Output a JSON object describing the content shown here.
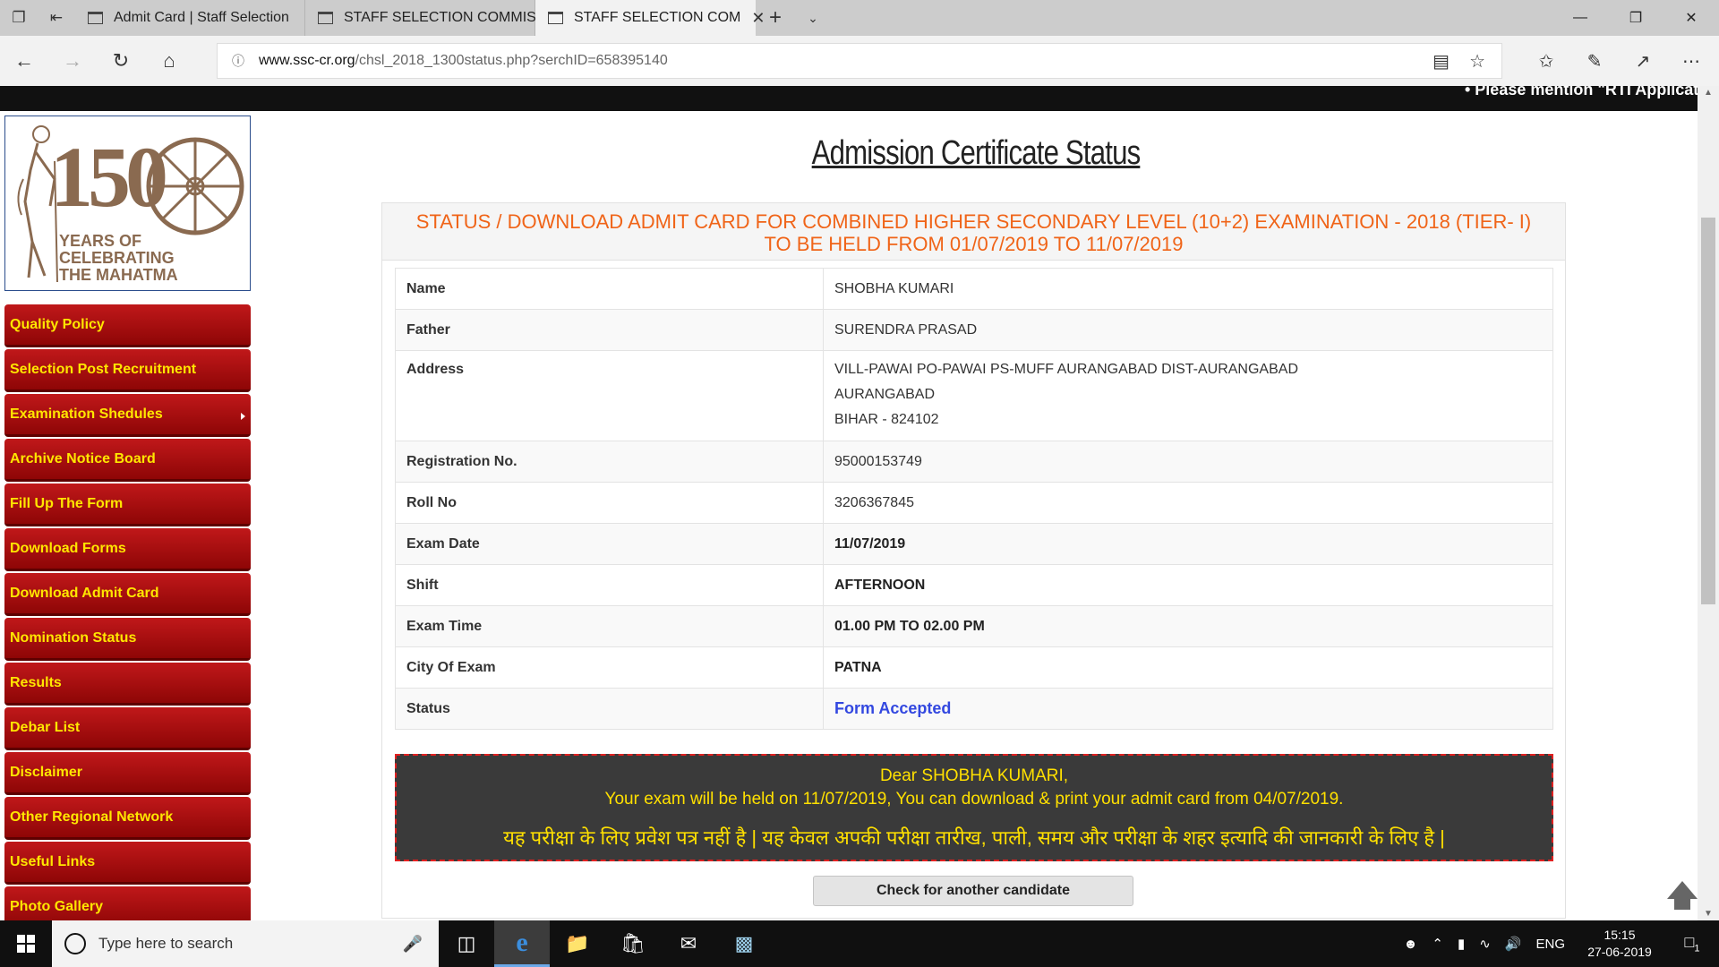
{
  "browser": {
    "tabs": [
      {
        "label": "Admit Card | Staff Selection",
        "active": false
      },
      {
        "label": "STAFF SELECTION COMMIS",
        "active": false
      },
      {
        "label": "STAFF SELECTION COM",
        "active": true
      }
    ],
    "url_host": "www.ssc-cr.org",
    "url_path": "/chsl_2018_1300status.php?serchID=658395140"
  },
  "marquee_text": "• Please mention \"RTI Applicati",
  "logo": {
    "number": "150",
    "line1": "YEARS OF",
    "line2": "CELEBRATING",
    "line3": "THE MAHATMA"
  },
  "sidebar": {
    "items": [
      {
        "label": "Quality Policy"
      },
      {
        "label": "Selection Post Recruitment"
      },
      {
        "label": "Examination Shedules"
      },
      {
        "label": "Archive Notice Board"
      },
      {
        "label": "Fill Up The Form"
      },
      {
        "label": "Download Forms"
      },
      {
        "label": "Download Admit Card"
      },
      {
        "label": "Nomination Status"
      },
      {
        "label": "Results"
      },
      {
        "label": "Debar List"
      },
      {
        "label": "Disclaimer"
      },
      {
        "label": "Other Regional Network"
      },
      {
        "label": "Useful Links"
      },
      {
        "label": "Photo Gallery"
      }
    ]
  },
  "main": {
    "title": "Admission Certificate Status",
    "panel_heading_line1": "STATUS / DOWNLOAD ADMIT CARD FOR COMBINED HIGHER SECONDARY LEVEL (10+2) EXAMINATION - 2018 (TIER- I)",
    "panel_heading_line2": "TO BE HELD FROM 01/07/2019 TO 11/07/2019",
    "rows": {
      "name": {
        "label": "Name",
        "value": "SHOBHA KUMARI"
      },
      "father": {
        "label": "Father",
        "value": "SURENDRA PRASAD"
      },
      "address": {
        "label": "Address",
        "line1": "VILL-PAWAI PO-PAWAI PS-MUFF AURANGABAD DIST-AURANGABAD",
        "line2": "AURANGABAD",
        "line3": "BIHAR - 824102"
      },
      "registration": {
        "label": "Registration No.",
        "value": "95000153749"
      },
      "roll": {
        "label": "Roll No",
        "value": "3206367845"
      },
      "exam_date": {
        "label": "Exam Date",
        "value": "11/07/2019"
      },
      "shift": {
        "label": "Shift",
        "value": "AFTERNOON"
      },
      "exam_time": {
        "label": "Exam Time",
        "value": "01.00 PM TO 02.00 PM"
      },
      "city": {
        "label": "City Of Exam",
        "value": "PATNA"
      },
      "status": {
        "label": "Status",
        "value": "Form Accepted"
      }
    },
    "notice": {
      "line1": "Dear SHOBHA KUMARI,",
      "line2": "Your exam will be held on 11/07/2019, You can download & print your admit card from 04/07/2019.",
      "line3": "यह परीक्षा के लिए प्रवेश पत्र नहीं है | यह केवल अपकी परीक्षा तारीख, पाली, समय और परीक्षा के शहर इत्यादि की जानकारी के लिए है |"
    },
    "check_button": "Check for another candidate"
  },
  "taskbar": {
    "search_placeholder": "Type here to search",
    "language": "ENG",
    "time": "15:15",
    "date": "27-06-2019",
    "notification_count": "1"
  },
  "colors": {
    "menu_red": "#b31114",
    "menu_text": "#ffe600",
    "heading_orange": "#f06418",
    "status_blue": "#3348e0",
    "notice_bg": "#3a3a3a",
    "notice_text": "#ffe000"
  }
}
